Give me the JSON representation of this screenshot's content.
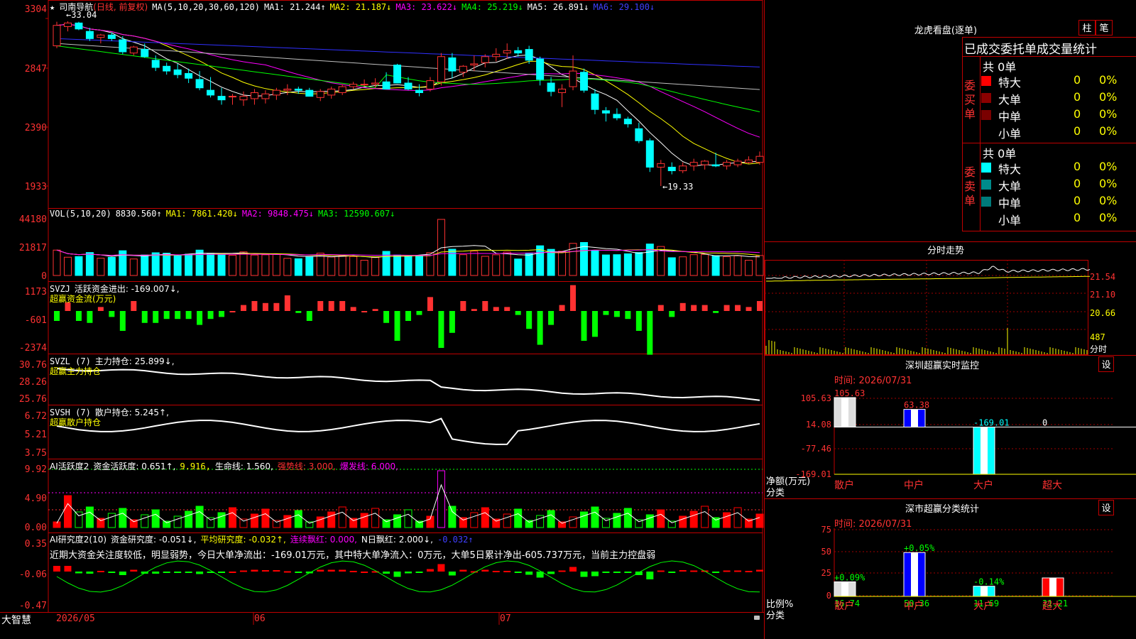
{
  "app": {
    "name": "大智慧"
  },
  "stock": {
    "star": "★",
    "name": "司南导航",
    "mode": "(日线, 前复权)"
  },
  "kline": {
    "ticks": [
      "3304",
      "2847",
      "2390",
      "1933"
    ],
    "ma_legend": {
      "label": "MA(5,10,20,30,60,120)",
      "ma1": "MA1: 21.244↑",
      "ma2": "MA2: 21.187↓",
      "ma3": "MA3: 23.622↓",
      "ma4": "MA4: 25.219↓",
      "ma5": "MA5: 26.891↓",
      "ma6": "MA6: 29.100↓"
    },
    "high_label": "←33.04",
    "low_label": "←19.33",
    "ohlc": [
      [
        31.0,
        33.0,
        30.8,
        32.7
      ],
      [
        32.6,
        33.04,
        32.2,
        32.9
      ],
      [
        32.9,
        33.0,
        32.3,
        32.4
      ],
      [
        32.2,
        32.5,
        31.4,
        31.6
      ],
      [
        31.7,
        32.0,
        31.2,
        31.9
      ],
      [
        31.9,
        32.1,
        31.4,
        31.6
      ],
      [
        31.5,
        31.8,
        30.3,
        30.5
      ],
      [
        30.4,
        31.0,
        30.2,
        30.9
      ],
      [
        30.7,
        31.2,
        30.0,
        30.1
      ],
      [
        29.8,
        30.2,
        28.9,
        29.2
      ],
      [
        29.3,
        29.6,
        28.6,
        28.9
      ],
      [
        29.0,
        29.5,
        28.3,
        28.6
      ],
      [
        28.7,
        29.1,
        27.9,
        28.3
      ],
      [
        28.2,
        28.9,
        27.3,
        27.5
      ],
      [
        27.3,
        28.4,
        26.7,
        26.9
      ],
      [
        26.8,
        27.5,
        26.1,
        26.5
      ],
      [
        26.8,
        27.0,
        26.1,
        26.8
      ],
      [
        26.5,
        27.2,
        26.0,
        26.8
      ],
      [
        26.6,
        27.4,
        26.1,
        27.1
      ],
      [
        26.6,
        27.3,
        26.2,
        27.0
      ],
      [
        26.9,
        27.5,
        26.5,
        27.3
      ],
      [
        27.3,
        27.8,
        26.9,
        27.4
      ],
      [
        27.4,
        27.6,
        27.0,
        27.3
      ],
      [
        27.3,
        27.5,
        26.8,
        26.8
      ],
      [
        26.7,
        27.4,
        26.4,
        27.2
      ],
      [
        26.9,
        27.6,
        26.6,
        27.4
      ],
      [
        27.1,
        27.8,
        26.9,
        27.6
      ],
      [
        27.6,
        28.0,
        27.4,
        27.8
      ],
      [
        27.8,
        28.2,
        27.6,
        27.8
      ],
      [
        27.8,
        28.3,
        27.5,
        27.9
      ],
      [
        28.0,
        28.8,
        27.8,
        27.4
      ],
      [
        29.4,
        29.5,
        28.8,
        27.9
      ],
      [
        27.9,
        28.4,
        27.3,
        27.4
      ],
      [
        27.3,
        27.8,
        26.8,
        27.1
      ],
      [
        27.4,
        28.4,
        27.2,
        28.1
      ],
      [
        28.0,
        30.4,
        27.7,
        30.1
      ],
      [
        30.0,
        30.4,
        28.3,
        28.9
      ],
      [
        28.8,
        29.4,
        28.4,
        29.3
      ],
      [
        29.4,
        30.2,
        28.9,
        29.5
      ],
      [
        29.6,
        30.3,
        29.2,
        30.1
      ],
      [
        30.1,
        30.8,
        29.7,
        30.3
      ],
      [
        30.4,
        31.2,
        29.9,
        30.6
      ],
      [
        30.6,
        30.9,
        30.1,
        30.4
      ],
      [
        30.7,
        31.0,
        29.5,
        29.8
      ],
      [
        29.9,
        30.1,
        27.7,
        28.2
      ],
      [
        27.9,
        28.4,
        26.8,
        27.2
      ],
      [
        27.1,
        27.8,
        25.9,
        27.4
      ],
      [
        27.6,
        30.2,
        27.3,
        28.9
      ],
      [
        28.8,
        29.1,
        27.1,
        27.3
      ],
      [
        27.0,
        27.4,
        25.3,
        25.7
      ],
      [
        25.6,
        25.9,
        24.7,
        25.4
      ],
      [
        25.3,
        25.8,
        24.8,
        25.0
      ],
      [
        24.9,
        25.1,
        24.2,
        24.5
      ],
      [
        24.1,
        24.6,
        22.9,
        23.1
      ],
      [
        23.1,
        23.3,
        20.5,
        20.9
      ],
      [
        20.9,
        21.5,
        19.33,
        21.2
      ],
      [
        20.9,
        21.3,
        20.3,
        20.6
      ],
      [
        20.6,
        21.3,
        20.4,
        21.0
      ],
      [
        21.0,
        21.6,
        20.6,
        21.3
      ],
      [
        21.1,
        21.5,
        20.7,
        21.4
      ],
      [
        21.1,
        22.1,
        20.9,
        21.0
      ],
      [
        21.0,
        21.5,
        20.7,
        21.3
      ],
      [
        21.1,
        21.6,
        20.9,
        21.4
      ],
      [
        21.3,
        21.8,
        21.2,
        21.5
      ],
      [
        21.3,
        22.2,
        21.1,
        21.8
      ]
    ]
  },
  "volume": {
    "ticks": [
      "44180",
      "21817",
      "0"
    ],
    "legend": {
      "label": "VOL(5,10,20)",
      "value": "8830.560↑",
      "ma1": "MA1: 7861.420↓",
      "ma2": "MA2: 9848.475↓",
      "ma3": "MA3: 12590.607↓"
    }
  },
  "svzj": {
    "ticks": [
      "1173",
      "-601",
      "-2374"
    ],
    "legend": {
      "label": "SVZJ",
      "value": "活跃资金进出: -169.007↓,",
      "sub": "超赢资金流(万元)"
    }
  },
  "svzl": {
    "ticks": [
      "30.76",
      "28.26",
      "25.76"
    ],
    "legend": {
      "label": "SVZL (7)",
      "value": "主力持仓: 25.899↓,",
      "sub": "超赢主力持仓"
    }
  },
  "svsh": {
    "ticks": [
      "6.72",
      "5.21",
      "3.75"
    ],
    "legend": {
      "label": "SVSH (7)",
      "value": "散户持仓: 5.245↑,",
      "sub": "超赢散户持仓"
    }
  },
  "ai1": {
    "ticks": [
      "9.92",
      "4.90",
      "0.00"
    ],
    "legend": {
      "label": "AI活跃度2",
      "a": "资金活跃度: 0.651↑,",
      "b": "9.916,",
      "c": "生命线: 1.560,",
      "d": "强势线: 3.000,",
      "e": "爆发线: 6.000,"
    }
  },
  "ai2": {
    "ticks": [
      "0.35",
      "-0.06",
      "-0.47"
    ],
    "legend": {
      "label": "AI研究度2(10)",
      "a": "资金研究度: -0.051↓,",
      "b": "平均研究度: -0.032↑,",
      "c": "连续飘红: 0.000,",
      "d": "N日飘红: 2.000↓,",
      "e": "-0.032↑"
    },
    "comment": "近期大资金关注度较低，明显弱势，今日大单净流出：-169.01万元，其中特大单净流入：0万元，大单5日累计净出-605.737万元，当前主力控盘弱"
  },
  "dates": {
    "d1": "2026/05",
    "d2": "06",
    "d3": "07"
  },
  "longhu": {
    "title": "龙虎看盘(逐单)",
    "btn1": "柱",
    "btn2": "笔",
    "header": "已成交委托单成交量统计",
    "buy": {
      "label": "委买单",
      "total": "共 0单",
      "rows": [
        {
          "name": "特大",
          "val": "0",
          "pct": "0%",
          "color": "#ff0000"
        },
        {
          "name": "大单",
          "val": "0",
          "pct": "0%",
          "color": "#8b0000"
        },
        {
          "name": "中单",
          "val": "0",
          "pct": "0%",
          "color": "#7a0000"
        },
        {
          "name": "小单",
          "val": "0",
          "pct": "0%",
          "color": "#000000"
        }
      ]
    },
    "sell": {
      "label": "委卖单",
      "total": "共 0单",
      "rows": [
        {
          "name": "特大",
          "val": "0",
          "pct": "0%",
          "color": "#00ffff"
        },
        {
          "name": "大单",
          "val": "0",
          "pct": "0%",
          "color": "#008b8b"
        },
        {
          "name": "中单",
          "val": "0",
          "pct": "0%",
          "color": "#007a7a"
        },
        {
          "name": "小单",
          "val": "0",
          "pct": "0%",
          "color": "#000000"
        }
      ]
    }
  },
  "fenshi": {
    "title": "分时走势",
    "ticks": [
      "21.54",
      "21.10",
      "20.66",
      "487"
    ],
    "unit": "分时"
  },
  "monitor": {
    "title": "深圳超赢实时监控",
    "set": "设",
    "time": "时间: 2026/07/31",
    "ticks": [
      "105.63",
      "14.08",
      "-77.46",
      "-169.01"
    ],
    "ylabel": "净额(万元)",
    "xlabel": "分类",
    "chart_data": {
      "type": "bar",
      "categories": [
        "散户",
        "中户",
        "大户",
        "超大"
      ],
      "values": [
        105.63,
        63.38,
        -169.01,
        0
      ],
      "value_labels": [
        "105.63",
        "63.38",
        "-169.01",
        "0"
      ],
      "ylim": [
        -169.01,
        105.63
      ]
    }
  },
  "classify": {
    "title": "深市超赢分类统计",
    "set": "设",
    "time": "时间: 2026/07/31",
    "ticks": [
      "75",
      "50",
      "25",
      "0"
    ],
    "ylabel": "比例%",
    "xlabel": "分类",
    "chart_data": {
      "type": "bar",
      "categories": [
        "散户",
        "中户",
        "大户",
        "超大"
      ],
      "values": [
        16.74,
        50.36,
        11.69,
        21.21
      ],
      "value_labels": [
        "16.74",
        "50.36",
        "11.69",
        "21.21"
      ],
      "changes": [
        "+0.09%",
        "+0.05%",
        "-0.14%",
        ""
      ],
      "ylim": [
        0,
        75
      ]
    }
  }
}
